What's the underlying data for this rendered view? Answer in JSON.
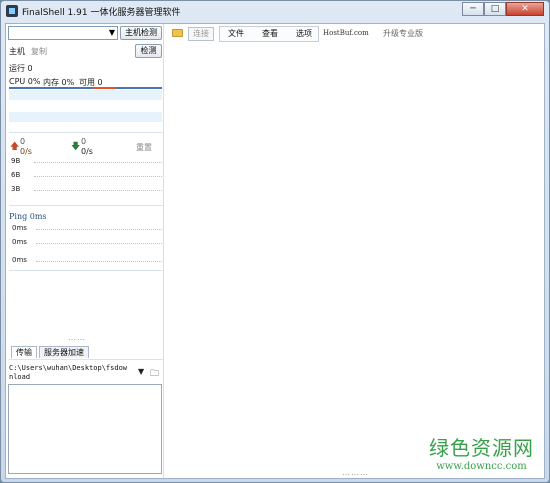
{
  "window": {
    "title": "FinalShell 1.91 一体化服务器管理软件",
    "controls": [
      "─",
      "□",
      "✕"
    ]
  },
  "left_panel": {
    "host_check_button": "主机检测",
    "host_label": "主机",
    "copy_label": "复制",
    "check_button": "检测",
    "uptime": "运行 0",
    "cpu": "CPU 0%",
    "memory": "内存 0%",
    "available": "可用 0",
    "upload": {
      "value": "0",
      "rate": "0/s"
    },
    "download": {
      "value": "0",
      "rate": "0/s"
    },
    "reset_label": "重置",
    "traffic_ticks": [
      "9B",
      "6B",
      "3B"
    ],
    "ping_title": "Ping 0ms",
    "ping_ticks": [
      "0ms",
      "0ms",
      "0ms"
    ],
    "tabs": [
      "传输",
      "服务器加速"
    ],
    "path": "C:\\Users\\wuhan\\Desktop\\fsdownload"
  },
  "toolbar": {
    "connect": "连接",
    "file": "文件",
    "view": "查看",
    "options": "选项",
    "brand": "HostBuf.com",
    "upgrade": "升级专业版"
  },
  "watermark": {
    "main": "绿色资源网",
    "sub": "www.downcc.com"
  }
}
